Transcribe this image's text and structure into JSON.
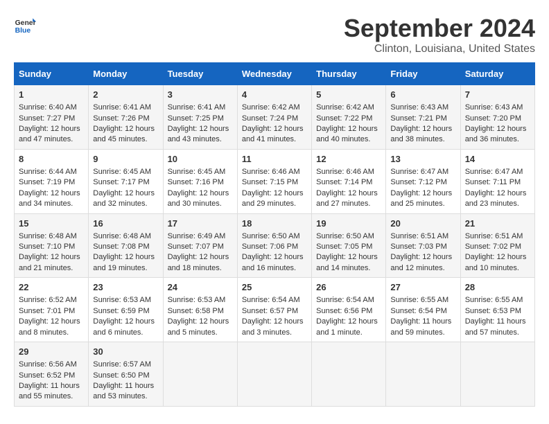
{
  "header": {
    "logo_line1": "General",
    "logo_line2": "Blue",
    "month_title": "September 2024",
    "location": "Clinton, Louisiana, United States"
  },
  "days_of_week": [
    "Sunday",
    "Monday",
    "Tuesday",
    "Wednesday",
    "Thursday",
    "Friday",
    "Saturday"
  ],
  "weeks": [
    [
      {
        "day": "1",
        "sunrise": "Sunrise: 6:40 AM",
        "sunset": "Sunset: 7:27 PM",
        "daylight": "Daylight: 12 hours and 47 minutes."
      },
      {
        "day": "2",
        "sunrise": "Sunrise: 6:41 AM",
        "sunset": "Sunset: 7:26 PM",
        "daylight": "Daylight: 12 hours and 45 minutes."
      },
      {
        "day": "3",
        "sunrise": "Sunrise: 6:41 AM",
        "sunset": "Sunset: 7:25 PM",
        "daylight": "Daylight: 12 hours and 43 minutes."
      },
      {
        "day": "4",
        "sunrise": "Sunrise: 6:42 AM",
        "sunset": "Sunset: 7:24 PM",
        "daylight": "Daylight: 12 hours and 41 minutes."
      },
      {
        "day": "5",
        "sunrise": "Sunrise: 6:42 AM",
        "sunset": "Sunset: 7:22 PM",
        "daylight": "Daylight: 12 hours and 40 minutes."
      },
      {
        "day": "6",
        "sunrise": "Sunrise: 6:43 AM",
        "sunset": "Sunset: 7:21 PM",
        "daylight": "Daylight: 12 hours and 38 minutes."
      },
      {
        "day": "7",
        "sunrise": "Sunrise: 6:43 AM",
        "sunset": "Sunset: 7:20 PM",
        "daylight": "Daylight: 12 hours and 36 minutes."
      }
    ],
    [
      {
        "day": "8",
        "sunrise": "Sunrise: 6:44 AM",
        "sunset": "Sunset: 7:19 PM",
        "daylight": "Daylight: 12 hours and 34 minutes."
      },
      {
        "day": "9",
        "sunrise": "Sunrise: 6:45 AM",
        "sunset": "Sunset: 7:17 PM",
        "daylight": "Daylight: 12 hours and 32 minutes."
      },
      {
        "day": "10",
        "sunrise": "Sunrise: 6:45 AM",
        "sunset": "Sunset: 7:16 PM",
        "daylight": "Daylight: 12 hours and 30 minutes."
      },
      {
        "day": "11",
        "sunrise": "Sunrise: 6:46 AM",
        "sunset": "Sunset: 7:15 PM",
        "daylight": "Daylight: 12 hours and 29 minutes."
      },
      {
        "day": "12",
        "sunrise": "Sunrise: 6:46 AM",
        "sunset": "Sunset: 7:14 PM",
        "daylight": "Daylight: 12 hours and 27 minutes."
      },
      {
        "day": "13",
        "sunrise": "Sunrise: 6:47 AM",
        "sunset": "Sunset: 7:12 PM",
        "daylight": "Daylight: 12 hours and 25 minutes."
      },
      {
        "day": "14",
        "sunrise": "Sunrise: 6:47 AM",
        "sunset": "Sunset: 7:11 PM",
        "daylight": "Daylight: 12 hours and 23 minutes."
      }
    ],
    [
      {
        "day": "15",
        "sunrise": "Sunrise: 6:48 AM",
        "sunset": "Sunset: 7:10 PM",
        "daylight": "Daylight: 12 hours and 21 minutes."
      },
      {
        "day": "16",
        "sunrise": "Sunrise: 6:48 AM",
        "sunset": "Sunset: 7:08 PM",
        "daylight": "Daylight: 12 hours and 19 minutes."
      },
      {
        "day": "17",
        "sunrise": "Sunrise: 6:49 AM",
        "sunset": "Sunset: 7:07 PM",
        "daylight": "Daylight: 12 hours and 18 minutes."
      },
      {
        "day": "18",
        "sunrise": "Sunrise: 6:50 AM",
        "sunset": "Sunset: 7:06 PM",
        "daylight": "Daylight: 12 hours and 16 minutes."
      },
      {
        "day": "19",
        "sunrise": "Sunrise: 6:50 AM",
        "sunset": "Sunset: 7:05 PM",
        "daylight": "Daylight: 12 hours and 14 minutes."
      },
      {
        "day": "20",
        "sunrise": "Sunrise: 6:51 AM",
        "sunset": "Sunset: 7:03 PM",
        "daylight": "Daylight: 12 hours and 12 minutes."
      },
      {
        "day": "21",
        "sunrise": "Sunrise: 6:51 AM",
        "sunset": "Sunset: 7:02 PM",
        "daylight": "Daylight: 12 hours and 10 minutes."
      }
    ],
    [
      {
        "day": "22",
        "sunrise": "Sunrise: 6:52 AM",
        "sunset": "Sunset: 7:01 PM",
        "daylight": "Daylight: 12 hours and 8 minutes."
      },
      {
        "day": "23",
        "sunrise": "Sunrise: 6:53 AM",
        "sunset": "Sunset: 6:59 PM",
        "daylight": "Daylight: 12 hours and 6 minutes."
      },
      {
        "day": "24",
        "sunrise": "Sunrise: 6:53 AM",
        "sunset": "Sunset: 6:58 PM",
        "daylight": "Daylight: 12 hours and 5 minutes."
      },
      {
        "day": "25",
        "sunrise": "Sunrise: 6:54 AM",
        "sunset": "Sunset: 6:57 PM",
        "daylight": "Daylight: 12 hours and 3 minutes."
      },
      {
        "day": "26",
        "sunrise": "Sunrise: 6:54 AM",
        "sunset": "Sunset: 6:56 PM",
        "daylight": "Daylight: 12 hours and 1 minute."
      },
      {
        "day": "27",
        "sunrise": "Sunrise: 6:55 AM",
        "sunset": "Sunset: 6:54 PM",
        "daylight": "Daylight: 11 hours and 59 minutes."
      },
      {
        "day": "28",
        "sunrise": "Sunrise: 6:55 AM",
        "sunset": "Sunset: 6:53 PM",
        "daylight": "Daylight: 11 hours and 57 minutes."
      }
    ],
    [
      {
        "day": "29",
        "sunrise": "Sunrise: 6:56 AM",
        "sunset": "Sunset: 6:52 PM",
        "daylight": "Daylight: 11 hours and 55 minutes."
      },
      {
        "day": "30",
        "sunrise": "Sunrise: 6:57 AM",
        "sunset": "Sunset: 6:50 PM",
        "daylight": "Daylight: 11 hours and 53 minutes."
      },
      {
        "day": "",
        "sunrise": "",
        "sunset": "",
        "daylight": ""
      },
      {
        "day": "",
        "sunrise": "",
        "sunset": "",
        "daylight": ""
      },
      {
        "day": "",
        "sunrise": "",
        "sunset": "",
        "daylight": ""
      },
      {
        "day": "",
        "sunrise": "",
        "sunset": "",
        "daylight": ""
      },
      {
        "day": "",
        "sunrise": "",
        "sunset": "",
        "daylight": ""
      }
    ]
  ]
}
